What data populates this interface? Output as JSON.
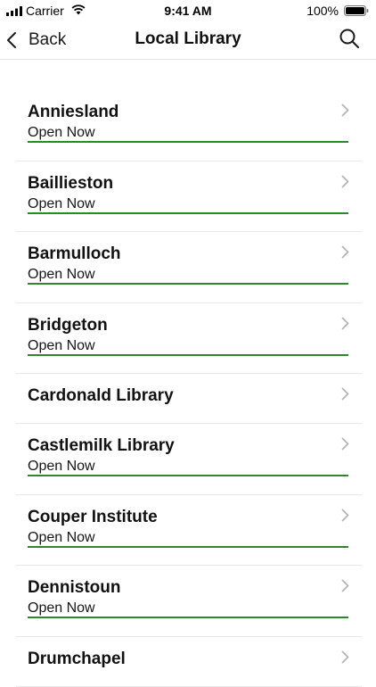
{
  "status_bar": {
    "carrier": "Carrier",
    "time": "9:41 AM",
    "battery": "100%"
  },
  "nav": {
    "back_label": "Back",
    "title": "Local Library"
  },
  "libraries": [
    {
      "name": "Anniesland",
      "status": "Open Now"
    },
    {
      "name": "Baillieston",
      "status": "Open Now"
    },
    {
      "name": "Barmulloch",
      "status": "Open Now"
    },
    {
      "name": "Bridgeton",
      "status": "Open Now"
    },
    {
      "name": "Cardonald Library",
      "status": null
    },
    {
      "name": "Castlemilk Library",
      "status": "Open Now"
    },
    {
      "name": "Couper Institute",
      "status": "Open Now"
    },
    {
      "name": "Dennistoun",
      "status": "Open Now"
    },
    {
      "name": "Drumchapel",
      "status": null
    }
  ],
  "colors": {
    "open_indicator": "#2a8a2a",
    "chevron": "#b5b5b5"
  }
}
